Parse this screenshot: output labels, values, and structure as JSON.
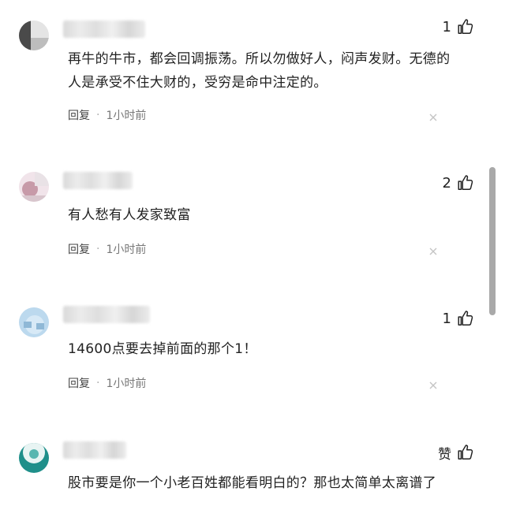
{
  "comments": [
    {
      "likes": "1",
      "text": "再牛的牛市，都会回调振荡。所以勿做好人，闷声发财。无德的人是承受不住大财的，受穷是命中注定的。",
      "reply_label": "回复",
      "separator": "·",
      "time": "1小时前"
    },
    {
      "likes": "2",
      "text": "有人愁有人发家致富",
      "reply_label": "回复",
      "separator": "·",
      "time": "1小时前"
    },
    {
      "likes": "1",
      "text": "14600点要去掉前面的那个1！",
      "reply_label": "回复",
      "separator": "·",
      "time": "1小时前"
    },
    {
      "likes": "赞",
      "text": "股市要是你一个小老百姓都能看明白的？那也太简单太离谱了",
      "reply_label": "",
      "separator": "",
      "time": ""
    }
  ],
  "icons": {
    "like": "thumbs-up-icon",
    "close": "close-icon"
  },
  "colors": {
    "text": "#222222",
    "muted": "#777777",
    "scrollbar": "#a9a9a9"
  }
}
